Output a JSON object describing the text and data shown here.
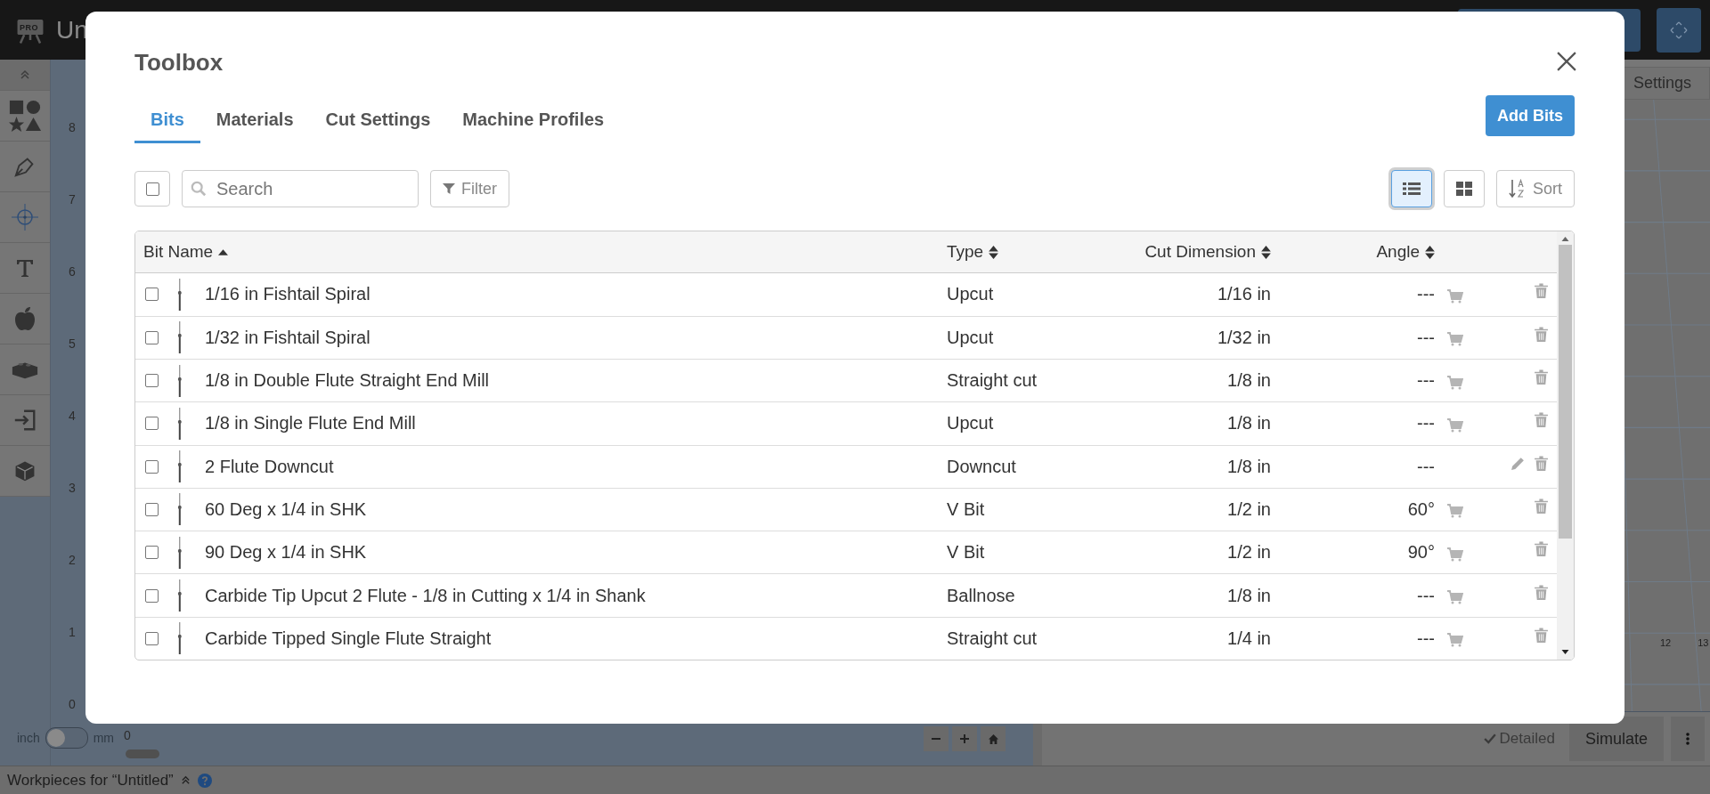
{
  "app": {
    "badge": "PRO",
    "title": "Un",
    "ruler": [
      "8",
      "7",
      "6",
      "5",
      "4",
      "3",
      "2",
      "1",
      "0"
    ],
    "ruler_origin": "0",
    "unit_toggle": {
      "left": "inch",
      "right": "mm",
      "on": false
    },
    "settings": "Settings",
    "axis_ticks": [
      "12",
      "13"
    ],
    "detailed": "Detailed",
    "simulate": "Simulate",
    "status": "Workpieces for “Untitled”"
  },
  "dialog": {
    "title": "Toolbox",
    "tabs": [
      {
        "label": "Bits",
        "selected": true
      },
      {
        "label": "Materials",
        "selected": false
      },
      {
        "label": "Cut Settings",
        "selected": false
      },
      {
        "label": "Machine Profiles",
        "selected": false
      }
    ],
    "add_button": "Add Bits",
    "select_all": {
      "checked": false
    },
    "search": {
      "placeholder": "Search"
    },
    "filter": "Filter",
    "views": [
      {
        "kind": "list",
        "selected": true
      },
      {
        "kind": "grid",
        "selected": false
      }
    ],
    "sort": "Sort",
    "columns": [
      {
        "label": "Bit Name",
        "sorted": true
      },
      {
        "label": "Type",
        "sorted": false
      },
      {
        "label": "Cut Dimension",
        "sorted": false
      },
      {
        "label": "Angle",
        "sorted": false
      }
    ],
    "rows": [
      {
        "checked": false,
        "name": "1/16 in Fishtail Spiral",
        "type": "Upcut",
        "cut": "1/16 in",
        "angle": "---",
        "cart": true,
        "editable": false
      },
      {
        "checked": false,
        "name": "1/32 in Fishtail Spiral",
        "type": "Upcut",
        "cut": "1/32 in",
        "angle": "---",
        "cart": true,
        "editable": false
      },
      {
        "checked": false,
        "name": "1/8 in Double Flute Straight End Mill",
        "type": "Straight cut",
        "cut": "1/8 in",
        "angle": "---",
        "cart": true,
        "editable": false
      },
      {
        "checked": false,
        "name": "1/8 in Single Flute End Mill",
        "type": "Upcut",
        "cut": "1/8 in",
        "angle": "---",
        "cart": true,
        "editable": false
      },
      {
        "checked": false,
        "name": "2 Flute Downcut",
        "type": "Downcut",
        "cut": "1/8 in",
        "angle": "---",
        "cart": false,
        "editable": true
      },
      {
        "checked": false,
        "name": "60 Deg x 1/4 in SHK",
        "type": "V Bit",
        "cut": "1/2 in",
        "angle": "60°",
        "cart": true,
        "editable": false
      },
      {
        "checked": false,
        "name": "90 Deg x 1/4 in SHK",
        "type": "V Bit",
        "cut": "1/2 in",
        "angle": "90°",
        "cart": true,
        "editable": false
      },
      {
        "checked": false,
        "name": "Carbide Tip Upcut 2 Flute - 1/8 in Cutting x 1/4 in Shank",
        "type": "Ballnose",
        "cut": "1/8 in",
        "angle": "---",
        "cart": true,
        "editable": false
      },
      {
        "checked": false,
        "name": "Carbide Tipped Single Flute Straight",
        "type": "Straight cut",
        "cut": "1/4 in",
        "angle": "---",
        "cart": true,
        "editable": false
      }
    ]
  }
}
